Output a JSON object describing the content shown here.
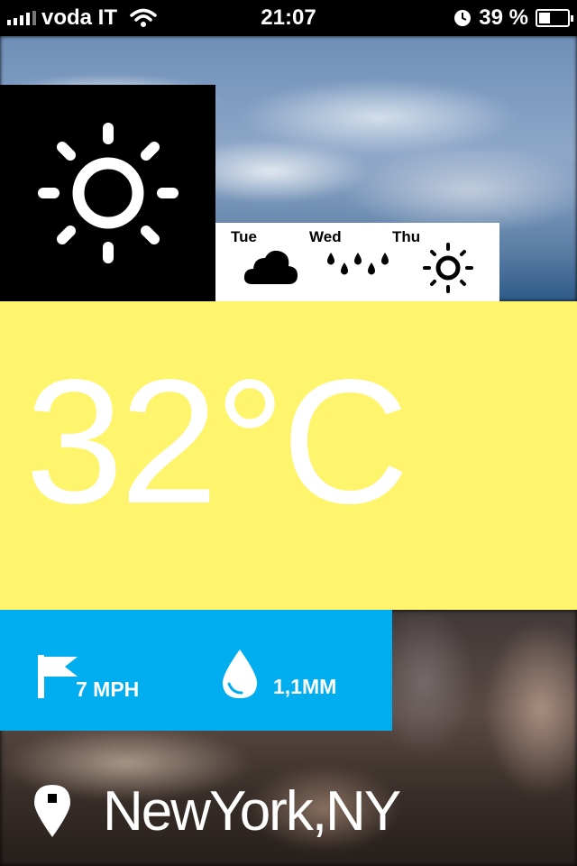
{
  "status_bar": {
    "carrier": "voda IT",
    "time": "21:07",
    "battery": "39 %",
    "battery_level": 0.39
  },
  "current": {
    "condition_icon": "sun-icon",
    "temperature": "32°C"
  },
  "forecast": [
    {
      "day": "Tue",
      "icon": "cloud-icon"
    },
    {
      "day": "Wed",
      "icon": "rain-icon"
    },
    {
      "day": "Thu",
      "icon": "sun-icon"
    }
  ],
  "stats": {
    "wind": "7 MPH",
    "wind_icon": "flag-icon",
    "precipitation": "1,1MM",
    "precipitation_icon": "water-drop-icon"
  },
  "location": {
    "icon": "map-pin-icon",
    "name": "NewYork,NY"
  },
  "colors": {
    "temperature_panel": "#fef56d",
    "stats_panel": "#00adef",
    "sun_tile": "#000000",
    "forecast_strip": "#ffffff"
  }
}
